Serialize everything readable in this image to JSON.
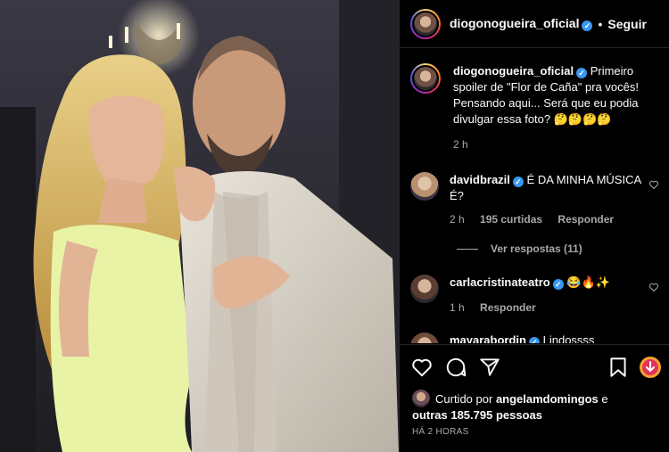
{
  "header": {
    "username": "diogonogueira_oficial",
    "separator": "•",
    "follow_label": "Seguir",
    "verified_mark": "✓"
  },
  "caption": {
    "username": "diogonogueira_oficial",
    "text": "Primeiro spoiler de \"Flor de Caña\" pra vocês! Pensando aqui... Será que eu podia divulgar essa foto? 🤔🤔🤔🤔",
    "time": "2 h"
  },
  "comments": [
    {
      "username": "davidbrazil",
      "text": "É DA MINHA MÚSICA É?",
      "time": "2 h",
      "likes": "195 curtidas",
      "reply_label": "Responder",
      "view_replies": "Ver respostas (11)"
    },
    {
      "username": "carlacristinateatro",
      "text": "😂🔥✨",
      "time": "1 h",
      "reply_label": "Responder"
    },
    {
      "username": "mayarabordin",
      "text": "Lindossss"
    }
  ],
  "likes": {
    "prefix": "Curtido por",
    "user": "angelamdomingos",
    "conj": "e",
    "others": "outras 185.795 pessoas"
  },
  "timestamp": "HÁ 2 HORAS",
  "icons": {
    "like": "heart-icon",
    "comment": "comment-icon",
    "share": "share-icon",
    "save": "bookmark-icon",
    "badge": "download-badge-icon"
  },
  "colors": {
    "accent_blue": "#3897f0",
    "background": "#000000",
    "text": "#fafafa",
    "muted": "#a8a8a8"
  }
}
